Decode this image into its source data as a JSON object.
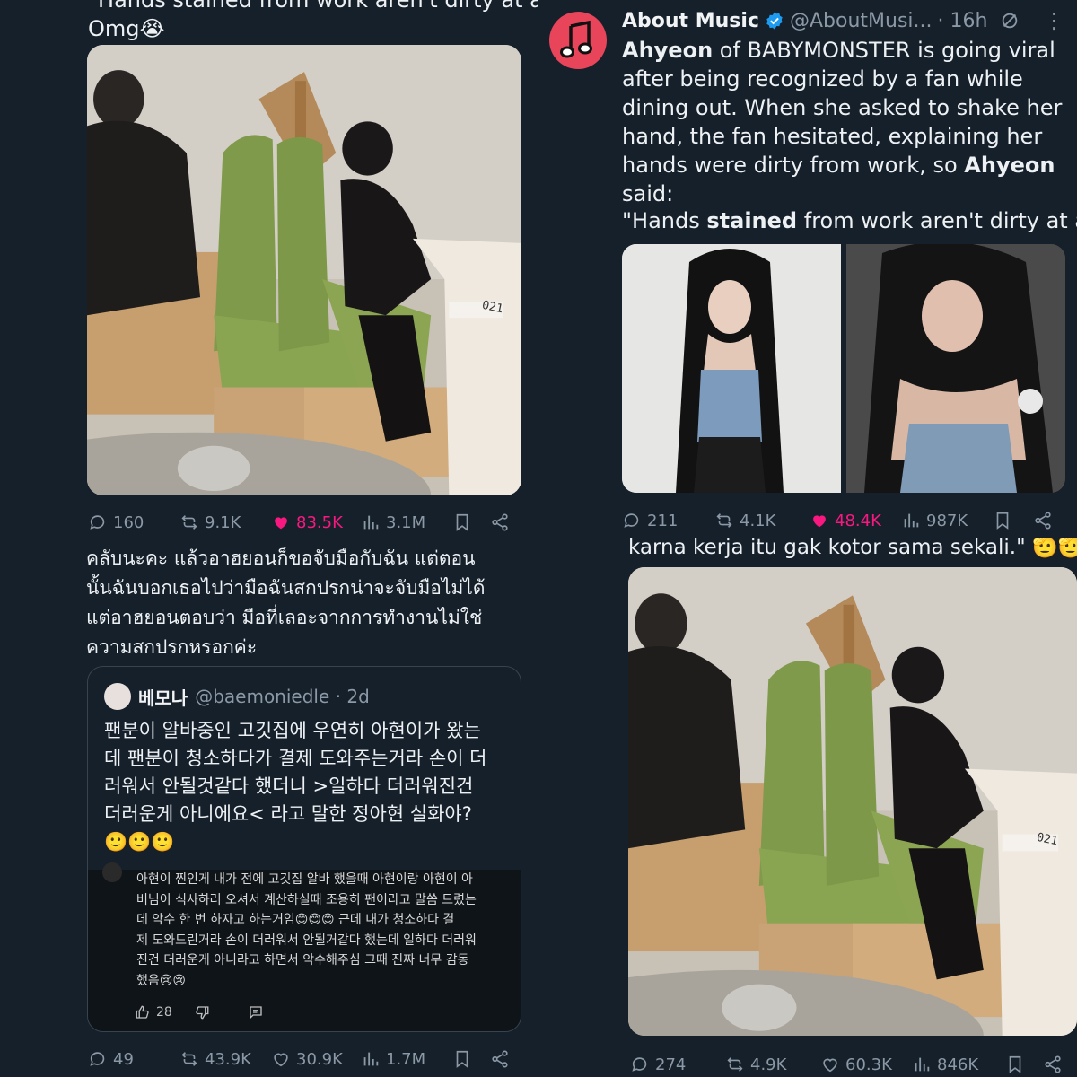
{
  "p1": {
    "top_text_line1": "\"Hands stained from work aren't dirty at all.\"",
    "top_text_line2": "Omg😭",
    "photo_desk_label": "021",
    "stats": {
      "replies": "160",
      "reposts": "9.1K",
      "likes": "83.5K",
      "views": "3.1M"
    }
  },
  "p2": {
    "account_name": "About Music",
    "handle": "@AboutMusi...",
    "time": "· 16h",
    "body_part1_bold": "Ahyeon",
    "body_part1": " of BABYMONSTER is going viral after being recognized by a fan while dining out. When she asked to shake her hand, the fan hesitated, explaining her hands were dirty from work, so ",
    "body_part2_bold": "Ahyeon",
    "body_part2": " said:",
    "quote_pre": "\"Hands ",
    "quote_bold": "stained",
    "quote_post": " from work aren't dirty at all.\"",
    "stats": {
      "replies": "211",
      "reposts": "4.1K",
      "likes": "48.4K",
      "views": "987K"
    }
  },
  "p3": {
    "thai_line1": "คลับนะคะ แล้วอาฮยอนก็ขอจับมือกับฉัน แต่ตอน",
    "thai_line2": "นั้นฉันบอกเธอไปว่ามือฉันสกปรกน่าจะจับมือไม่ได้",
    "thai_line3": "แต่อาฮยอนตอบว่า มือที่เลอะจากการทำงานไม่ใช่",
    "thai_line4": "ความสกปรกหรอกค่ะ",
    "quote_name": "베모나",
    "quote_handle": "@baemoniedle · 2d",
    "quote_line1": "팬분이 알바중인 고깃집에 우연히 아현이가 왔는",
    "quote_line2": "데 팬분이 청소하다가 결제 도와주는거라 손이 더",
    "quote_line3": "러워서 안될것같다 했더니 >일하다 더러워진건",
    "quote_line4": "더러운게 아니에요< 라고 말한 정아현 실화야?",
    "quote_line5": "🙂🙂🙂",
    "comment_line1": "아현이 찐인게 내가 전에 고깃집 알바 했을때 아현이랑 아현이 아",
    "comment_line2": "버님이 식사하러 오셔서 계산하실때 조용히 팬이라고 말씀 드렸는",
    "comment_line3": "데 악수 한 번 하자고 하는거임😊😊😊 근데 내가 청소하다 결",
    "comment_line4": "제 도와드린거라 손이 더러워서 안될거같다 했는데 일하다 더러워",
    "comment_line5": "진건 더러운게 아니라고 하면서 악수해주심 그때 진짜 너무 감동",
    "comment_line6": "했음😢😢",
    "comment_likes": "28",
    "stats": {
      "replies": "49",
      "reposts": "43.9K",
      "likes": "30.9K",
      "views": "1.7M"
    }
  },
  "p4": {
    "indo_text": "karna kerja itu gak kotor sama sekali.\" 🫡🫡",
    "photo_desk_label": "021",
    "stats": {
      "replies": "274",
      "reposts": "4.9K",
      "likes": "60.3K",
      "views": "846K"
    }
  },
  "colors": {
    "bg": "#15202b",
    "like": "#f91880",
    "muted": "#8b98a5",
    "verified": "#1d9bf0",
    "avatar": "#e8445a"
  },
  "icons": [
    "reply-icon",
    "repost-icon",
    "like-icon",
    "views-icon",
    "bookmark-icon",
    "share-icon",
    "verified-icon",
    "grok-icon",
    "more-icon",
    "music-note-icon"
  ]
}
